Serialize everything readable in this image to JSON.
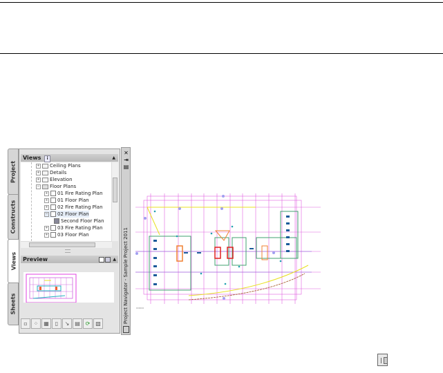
{
  "palette": {
    "tabs": [
      {
        "label": "Project"
      },
      {
        "label": "Constructs"
      },
      {
        "label": "Views"
      },
      {
        "label": "Sheets"
      }
    ],
    "views_header": {
      "label": "Views",
      "info_badge": "i"
    },
    "tree": [
      {
        "label": "Ceiling Plans",
        "level": 1,
        "type": "folder"
      },
      {
        "label": "Details",
        "level": 1,
        "type": "folder"
      },
      {
        "label": "Elevation",
        "level": 1,
        "type": "folder"
      },
      {
        "label": "Floor Plans",
        "level": 1,
        "type": "folder-open"
      },
      {
        "label": "01 Fire Rating Plan",
        "level": 2,
        "type": "view"
      },
      {
        "label": "01 Floor Plan",
        "level": 2,
        "type": "view"
      },
      {
        "label": "02 Fire Rating Plan",
        "level": 2,
        "type": "view"
      },
      {
        "label": "02 Floor Plan",
        "level": 2,
        "type": "view",
        "selected": true
      },
      {
        "label": "Second Floor Plan",
        "level": 3,
        "type": "model-space-view"
      },
      {
        "label": "03 Fire Rating Plan",
        "level": 2,
        "type": "view"
      },
      {
        "label": "03 Floor Plan",
        "level": 2,
        "type": "view"
      }
    ],
    "preview_header": {
      "label": "Preview"
    },
    "title": "Project Navigator - Sample Project 2011",
    "toolbar_icons": [
      "add-view-icon",
      "add-model-space-view-icon",
      "properties-icon",
      "delete-icon",
      "repath-icon",
      "reports-icon",
      "refresh-icon",
      "clipboard-icon"
    ]
  }
}
